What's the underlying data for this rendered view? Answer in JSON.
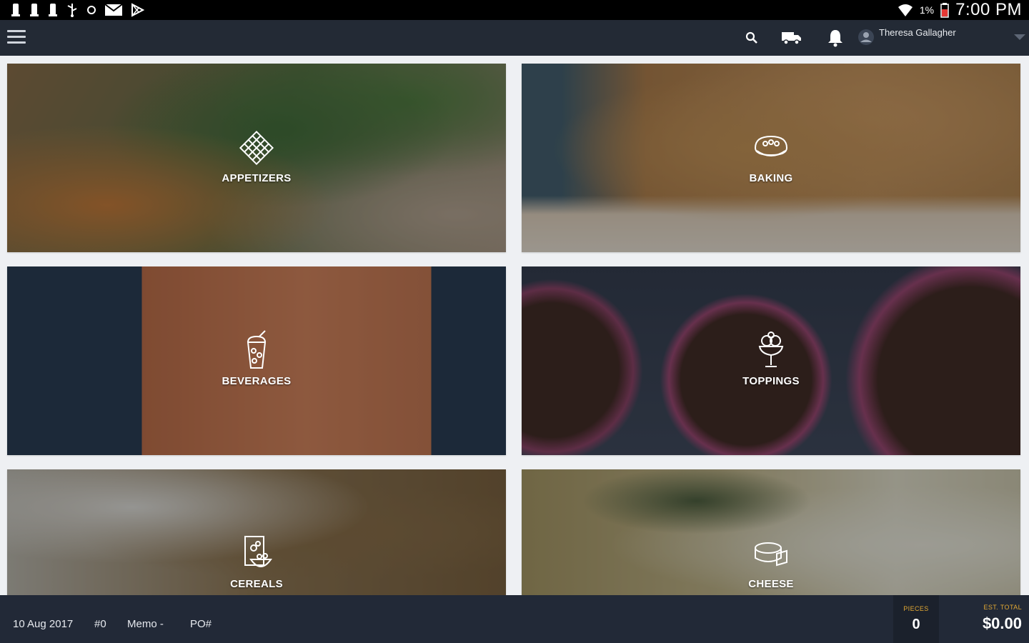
{
  "status_bar": {
    "battery_percent": "1%",
    "time": "7:00 PM",
    "icons": [
      "notification-icon",
      "notification-icon",
      "notification-icon",
      "usb-icon",
      "sync-icon",
      "mail-icon",
      "play-store-icon",
      "wifi-icon",
      "battery-low-icon"
    ]
  },
  "app_bar": {
    "icons": [
      "menu-icon",
      "search-icon",
      "delivery-truck-icon",
      "bell-icon",
      "account-icon",
      "chevron-down-icon"
    ],
    "user": {
      "name": "Theresa Gallagher",
      "subtitle": ""
    }
  },
  "categories": [
    {
      "label": "APPETIZERS",
      "icon": "waffle-icon"
    },
    {
      "label": "BAKING",
      "icon": "cake-icon"
    },
    {
      "label": "BEVERAGES",
      "icon": "drink-icon"
    },
    {
      "label": "TOPPINGS",
      "icon": "ice-cream-sundae-icon"
    },
    {
      "label": "CEREALS",
      "icon": "cereal-box-icon"
    },
    {
      "label": "CHEESE",
      "icon": "cheese-icon"
    }
  ],
  "bottom_bar": {
    "date": "10 Aug 2017",
    "order_number": "#0",
    "memo": "Memo -",
    "po": "PO#",
    "pieces_caption": "PIECES",
    "pieces_value": "0",
    "total_caption": "EST. TOTAL",
    "total_value": "$0.00"
  },
  "colors": {
    "app_bar": "#232a35",
    "bottom_bar": "#222937",
    "accent": "#e3a933"
  }
}
